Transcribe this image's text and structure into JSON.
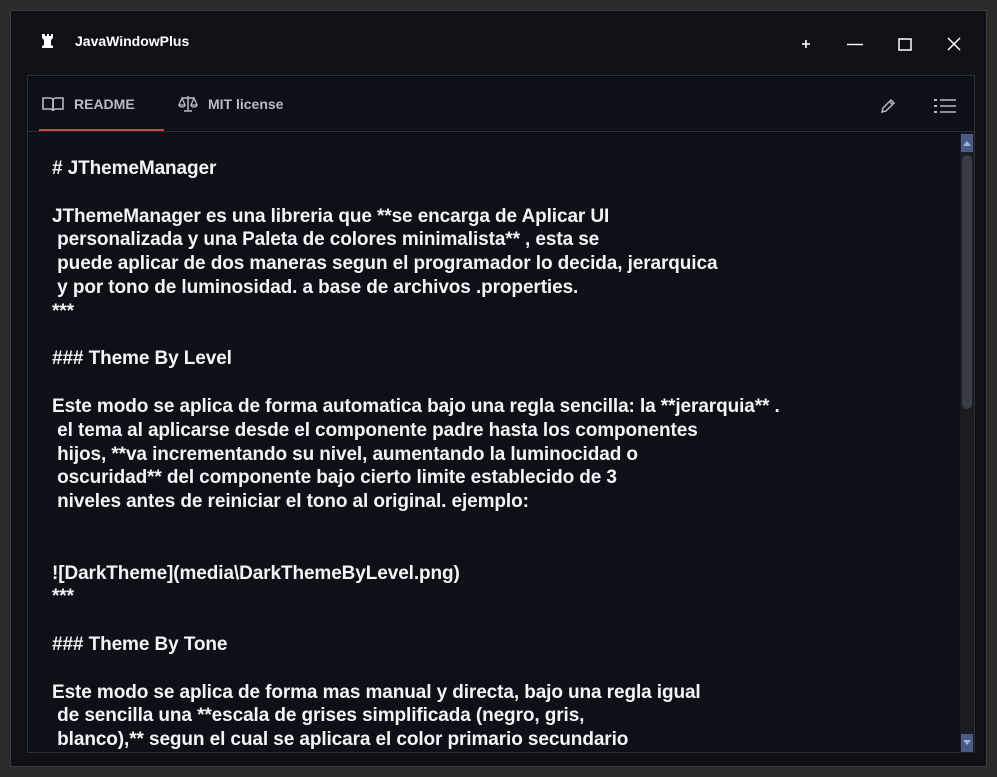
{
  "window": {
    "title": "JavaWindowPlus",
    "controls": [
      "plus-icon",
      "minimize-icon",
      "maximize-icon",
      "close-icon"
    ]
  },
  "tabs": [
    {
      "label": "README",
      "icon": "book-icon",
      "active": true
    },
    {
      "label": "MIT license",
      "icon": "scales-icon",
      "active": false
    }
  ],
  "toolbar": {
    "icons": [
      "pencil-icon",
      "list-icon"
    ]
  },
  "colors": {
    "accent": "#c94747",
    "background": "#101117",
    "text": "#f3f4f6",
    "scroll_arrow": "#4a5a86"
  },
  "readme": {
    "text": "# JThemeManager\n\nJThemeManager es una libreria que **se encarga de Aplicar UI\n personalizada y una Paleta de colores minimalista** , esta se\n puede aplicar de dos maneras segun el programador lo decida, jerarquica\n y por tono de luminosidad. a base de archivos .properties.\n***\n\n### Theme By Level\n\nEste modo se aplica de forma automatica bajo una regla sencilla: la **jerarquia** .\n el tema al aplicarse desde el componente padre hasta los componentes\n hijos, **va incrementando su nivel, aumentando la luminocidad o\n oscuridad** del componente bajo cierto limite establecido de 3\n niveles antes de reiniciar el tono al original. ejemplo:\n\n\n![DarkTheme](media\\DarkThemeByLevel.png)\n***\n\n### Theme By Tone\n\nEste modo se aplica de forma mas manual y directa, bajo una regla igual\n de sencilla una **escala de grises simplificada (negro, gris,\n blanco),** segun el cual se aplicara el color primario secundario"
  }
}
